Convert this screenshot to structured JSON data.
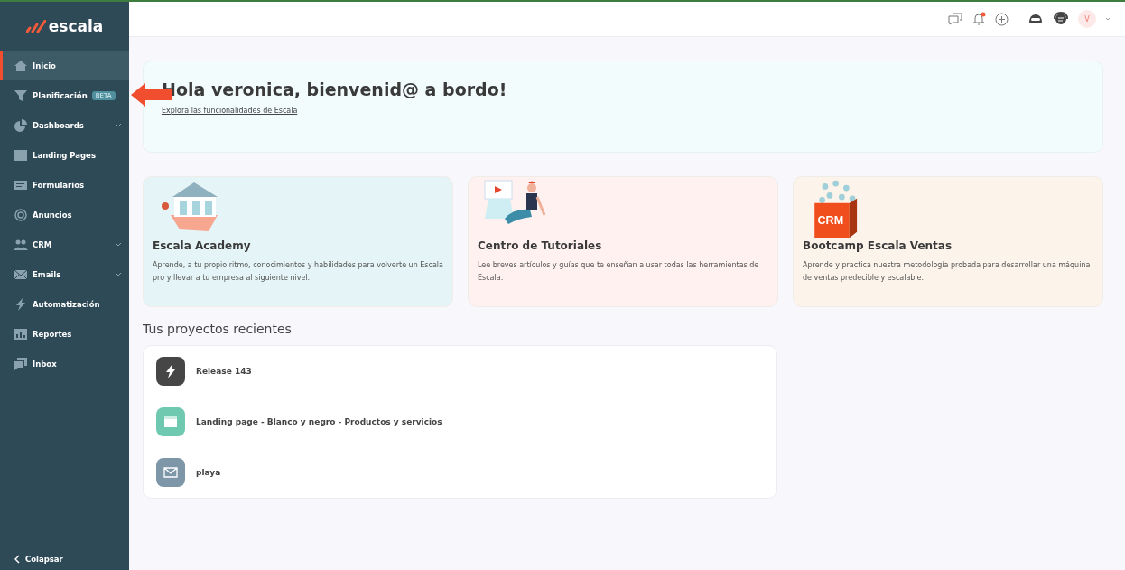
{
  "sidebar": {
    "logo": "escala",
    "items": [
      {
        "label": "Inicio",
        "selected": true,
        "expandable": false
      },
      {
        "label": "Planificación",
        "selected": false,
        "expandable": false,
        "badge": "BETA"
      },
      {
        "label": "Dashboards",
        "selected": false,
        "expandable": true
      },
      {
        "label": "Landing Pages",
        "selected": false,
        "expandable": false
      },
      {
        "label": "Formularios",
        "selected": false,
        "expandable": false
      },
      {
        "label": "Anuncios",
        "selected": false,
        "expandable": false
      },
      {
        "label": "CRM",
        "selected": false,
        "expandable": true
      },
      {
        "label": "Emails",
        "selected": false,
        "expandable": true
      },
      {
        "label": "Automatización",
        "selected": false,
        "expandable": false
      },
      {
        "label": "Reportes",
        "selected": false,
        "expandable": false
      },
      {
        "label": "Inbox",
        "selected": false,
        "expandable": false
      }
    ],
    "collapse": "Colapsar"
  },
  "topbar": {
    "avatar": "V",
    "notification_dot": true
  },
  "welcome": {
    "title": "Hola veronica, bienvenid@ a bordo!",
    "link": "Explora las funcionalidades de Escala"
  },
  "cards": [
    {
      "kind": "academy",
      "title": "Escala Academy",
      "text": "Aprende, a tu propio ritmo, conocimientos y habilidades para volverte un Escala pro y llevar a tu empresa al siguiente nivel.",
      "color": "#e5f4f6"
    },
    {
      "kind": "tutorials",
      "title": "Centro de Tutoriales",
      "text": "Lee breves artículos y guías que te enseñan a usar todas las herramientas de Escala.",
      "color": "#fff1f0"
    },
    {
      "kind": "bootcamp",
      "title": "Bootcamp Escala Ventas",
      "text": "Aprende y practica nuestra metodología probada para desarrollar una máquina de ventas predecible y escalable.",
      "color": "#fcf3ea",
      "badge": "CRM"
    }
  ],
  "recent": {
    "title": "Tus proyectos recientes",
    "items": [
      {
        "kind": "automation",
        "name": "Release 143",
        "color": "#464646"
      },
      {
        "kind": "landing",
        "name": "Landing page - Blanco y negro - Productos y servicios",
        "color": "#6fc9b1"
      },
      {
        "kind": "email",
        "name": "playa",
        "color": "#7d97a8"
      }
    ]
  }
}
